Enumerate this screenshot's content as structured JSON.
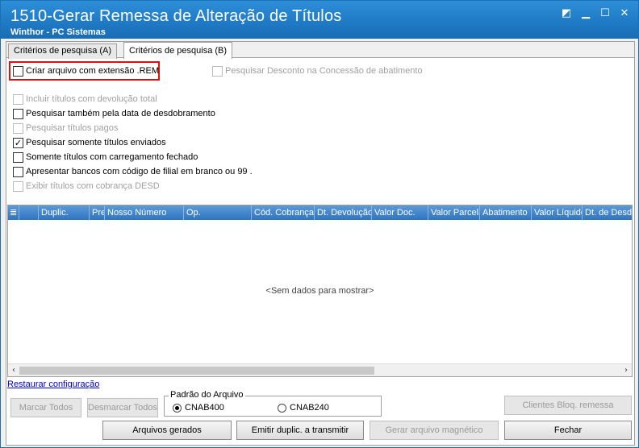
{
  "window": {
    "title": "1510-Gerar Remessa de Alteração de Títulos",
    "subtitle": "Winthor - PC Sistemas"
  },
  "tabs": [
    {
      "label": "Critérios de pesquisa (A)",
      "active": false
    },
    {
      "label": "Critérios de pesquisa (B)",
      "active": true
    }
  ],
  "options": {
    "criar_arquivo": {
      "label": "Criar arquivo com extensão .REM",
      "checked": false,
      "enabled": true
    },
    "pesquisar_desconto": {
      "label": "Pesquisar Desconto na Concessão de abatimento",
      "checked": false,
      "enabled": false
    },
    "incluir_devolucao": {
      "label": "Incluir títulos com devolução total",
      "checked": false,
      "enabled": false
    },
    "pesquisar_desdobramento": {
      "label": "Pesquisar também pela data de desdobramento",
      "checked": false,
      "enabled": true
    },
    "pesquisar_pagos": {
      "label": "Pesquisar títulos pagos",
      "checked": false,
      "enabled": false
    },
    "somente_enviados": {
      "label": "Pesquisar somente títulos enviados",
      "checked": true,
      "enabled": true
    },
    "carregamento_fechado": {
      "label": "Somente títulos com carregamento fechado",
      "checked": false,
      "enabled": true
    },
    "bancos_filial": {
      "label": "Apresentar bancos com código de filial em branco ou 99 .",
      "checked": false,
      "enabled": true
    },
    "exibir_desd": {
      "label": "Exibir títulos com cobrança DESD",
      "checked": false,
      "enabled": false
    }
  },
  "grid": {
    "columns": [
      "Duplic.",
      "Pre",
      "Nosso Número",
      "Op.",
      "Cód. Cobrança",
      "Dt. Devolução",
      "Valor Doc.",
      "Valor Parcela",
      "Abatimento",
      "Valor Líquido",
      "Dt. de Desdo"
    ],
    "empty_text": "<Sem dados para mostrar>"
  },
  "links": {
    "restore": "Restaurar configuração"
  },
  "buttons": {
    "marcar_todos": "Marcar Todos",
    "desmarcar_todos": "Desmarcar Todos",
    "clientes_bloq": "Clientes Bloq. remessa",
    "arquivos_gerados": "Arquivos gerados",
    "emitir_duplic": "Emitir duplic. a transmitir",
    "gerar_arquivo": "Gerar arquivo magnético",
    "fechar": "Fechar"
  },
  "padrao_arquivo": {
    "title": "Padrão do Arquivo",
    "options": [
      {
        "label": "CNAB400",
        "selected": true
      },
      {
        "label": "CNAB240",
        "selected": false
      }
    ]
  }
}
